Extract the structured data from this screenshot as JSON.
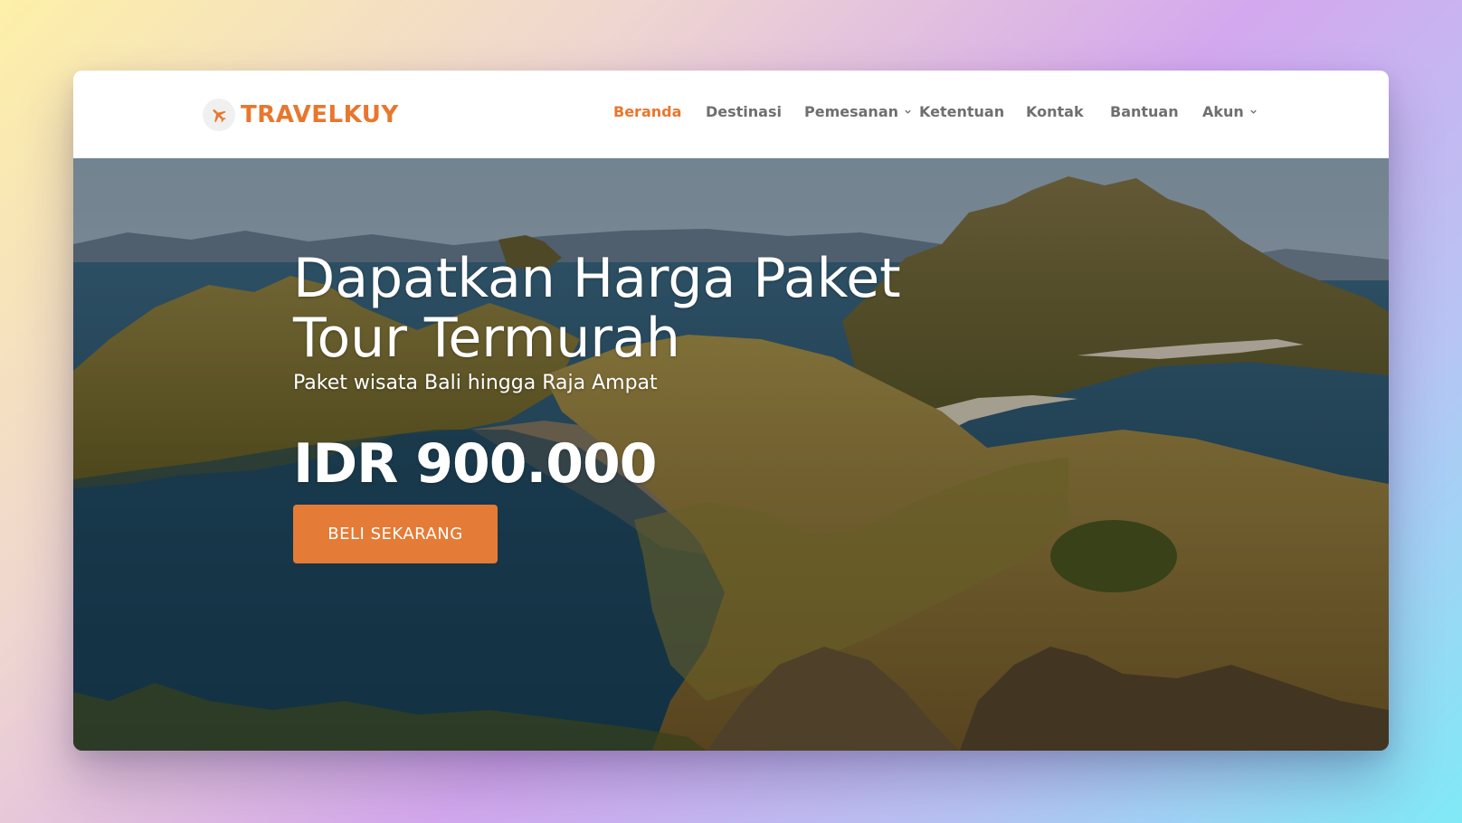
{
  "brand": {
    "name": "TRAVELKUY",
    "icon": "airplane-icon",
    "accent": "#e8772e"
  },
  "nav": {
    "items": [
      {
        "label": "Beranda",
        "active": true
      },
      {
        "label": "Destinasi"
      },
      {
        "label": "Pemesanan",
        "dropdown": true
      },
      {
        "label": "Ketentuan"
      },
      {
        "label": "Kontak"
      },
      {
        "label": "Bantuan"
      },
      {
        "label": "Akun",
        "dropdown": true
      }
    ]
  },
  "hero": {
    "title_line1": "Dapatkan Harga Paket",
    "title_line2": "Tour Termurah",
    "subtitle": "Paket wisata Bali hingga Raja Ampat",
    "price": "IDR 900.000",
    "cta_label": "BELI SEKARANG",
    "cta_color": "#e47b36"
  }
}
